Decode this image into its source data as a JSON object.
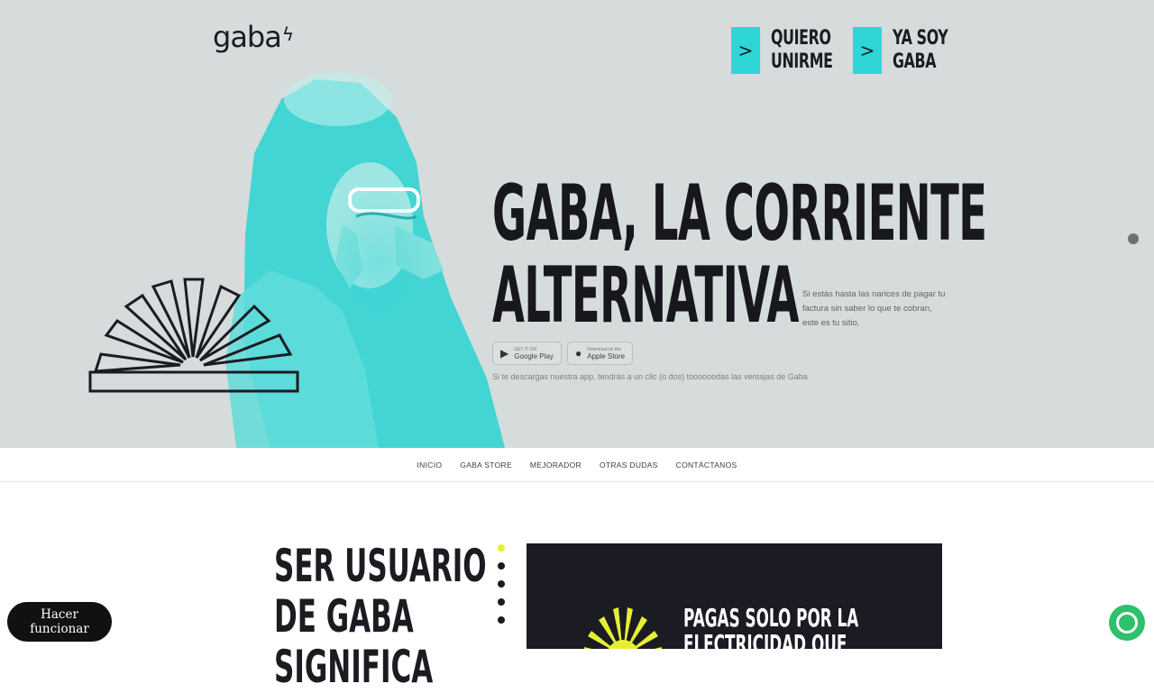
{
  "header": {
    "logo": "gaba",
    "logo_mark": "ϟ",
    "cta_join": {
      "arrow": ">",
      "line1": "QUIERO",
      "line2": "UNIRME"
    },
    "cta_member": {
      "arrow": ">",
      "line1": "YA SOY",
      "line2": "GABA"
    }
  },
  "hero": {
    "title_line1": "GABA, LA CORRIENTE",
    "title_line2": "ALTERNATIVA",
    "blurb": "Si estás hasta las narices de pagar tu factura sin saber lo que te cobran, este es tu sitio.",
    "google_play": {
      "small": "GET IT ON",
      "label": "Google Play",
      "icon": "▶"
    },
    "app_store": {
      "small": "Download on the",
      "label": "Apple Store",
      "icon": "●"
    },
    "tagline": "Si te descargas nuestra app, tendrás a un clic (o dos) toooooodas las ventajas de Gaba"
  },
  "nav": {
    "items": [
      "INICIO",
      "GABA STORE",
      "MEJORADOR",
      "OTRAS DUDAS",
      "CONTÁCTANOS"
    ]
  },
  "section": {
    "title_line1": "SER USUARIO",
    "title_line2": "DE GABA",
    "title_line3": "SIGNIFICA",
    "card_line1": "PAGAS SOLO POR LA",
    "card_line2": "ELECTRICIDAD QUE"
  },
  "floating": {
    "button_label": "Hacer funcionar",
    "chat_icon": "chat-bubble-icon"
  },
  "colors": {
    "accent_cyan": "#2fd6d6",
    "hero_bg": "#d5dcdb",
    "dark": "#1b1b24",
    "yellow": "#e6ef34",
    "chat_green": "#2ec06a"
  }
}
